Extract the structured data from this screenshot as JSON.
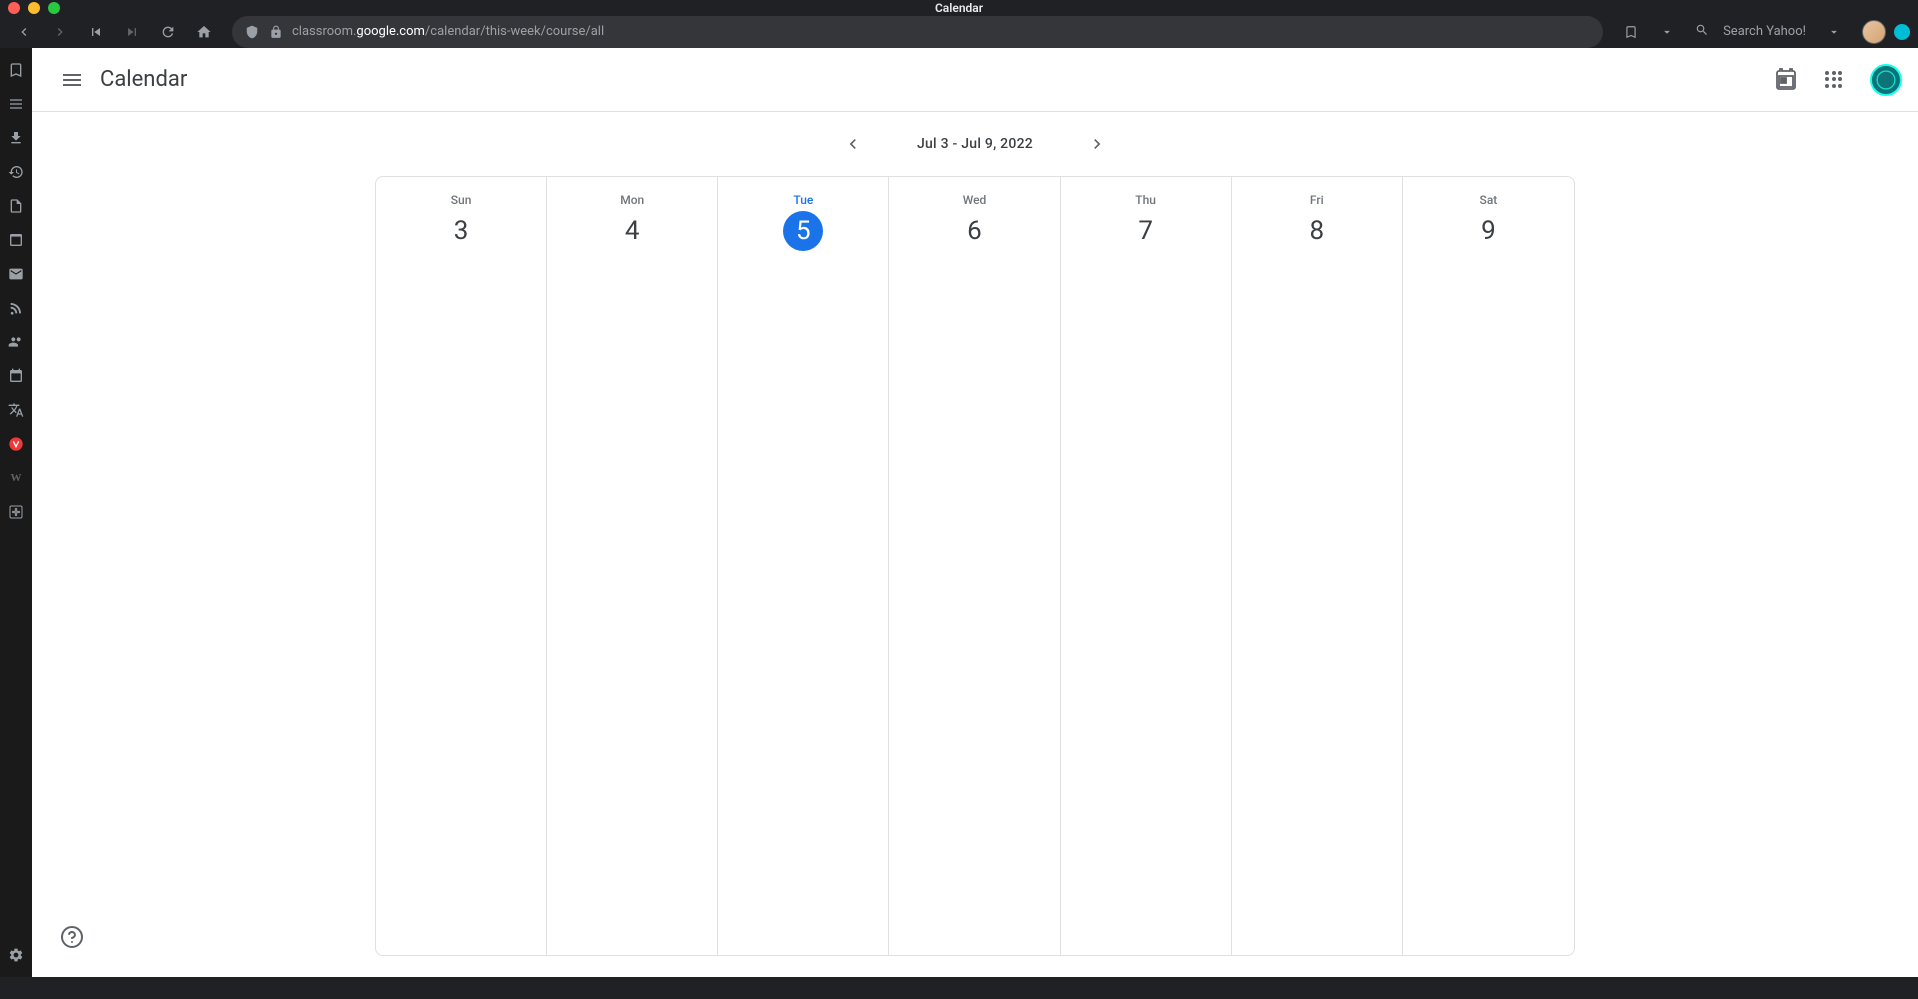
{
  "browser": {
    "tab_title": "Calendar",
    "url_domain": "classroom.google.com",
    "url_path": "/calendar/this-week/course/all",
    "search_placeholder": "Search Yahoo!"
  },
  "app": {
    "title": "Calendar",
    "date_range": "Jul 3 - Jul 9, 2022",
    "days": [
      {
        "name": "Sun",
        "number": "3",
        "today": false
      },
      {
        "name": "Mon",
        "number": "4",
        "today": false
      },
      {
        "name": "Tue",
        "number": "5",
        "today": true
      },
      {
        "name": "Wed",
        "number": "6",
        "today": false
      },
      {
        "name": "Thu",
        "number": "7",
        "today": false
      },
      {
        "name": "Fri",
        "number": "8",
        "today": false
      },
      {
        "name": "Sat",
        "number": "9",
        "today": false
      }
    ]
  }
}
